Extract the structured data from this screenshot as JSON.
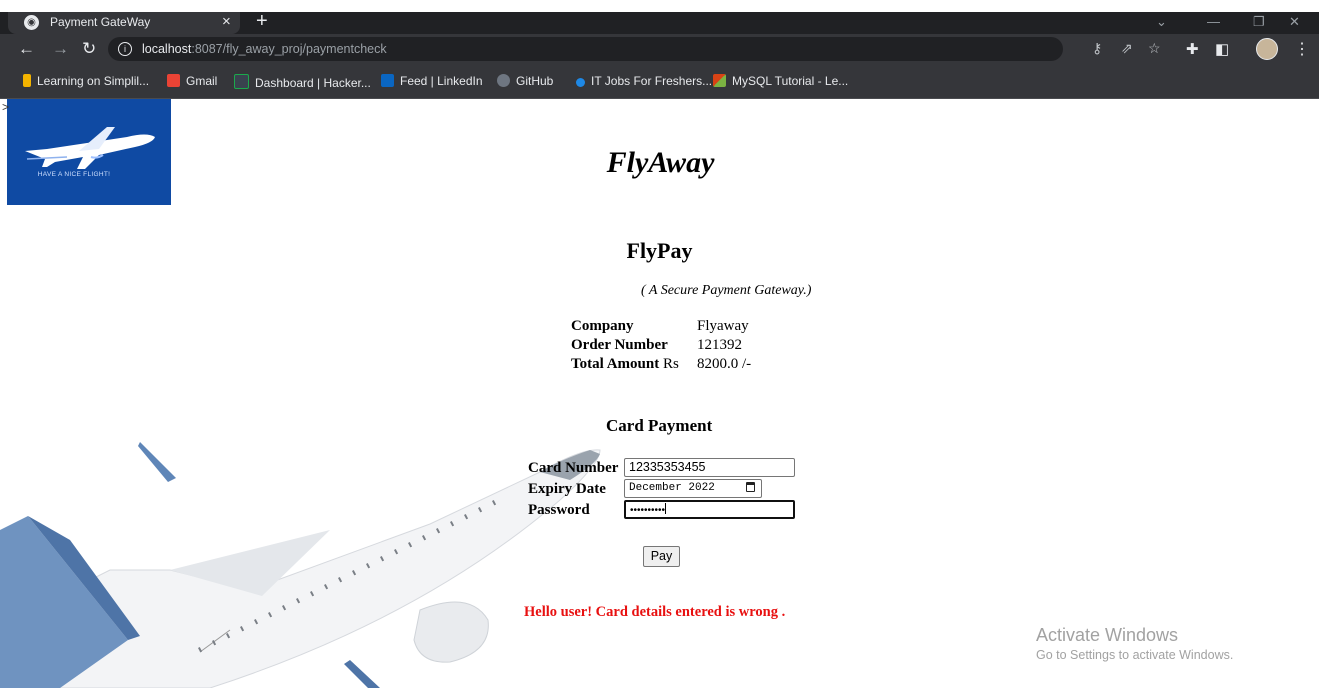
{
  "browser": {
    "tab_title": "Payment GateWay",
    "tab_close": "×",
    "new_tab": "+",
    "url_host": "localhost",
    "url_path": ":8087/fly_away_proj/paymentcheck",
    "bookmarks": [
      {
        "label": "Learning on Simplil...",
        "color": "#f4b400"
      },
      {
        "label": "Gmail",
        "color": "#ea4335"
      },
      {
        "label": "Dashboard | Hacker...",
        "color": "#0e141e"
      },
      {
        "label": "Feed | LinkedIn",
        "color": "#0a66c2"
      },
      {
        "label": "GitHub",
        "color": "#6e7681"
      },
      {
        "label": "IT Jobs For Freshers...",
        "color": "#1e88e5"
      },
      {
        "label": "MySQL Tutorial - Le...",
        "color": "#d84315"
      }
    ]
  },
  "page": {
    "stray_text": ">",
    "logo_tagline": "HAVE A NICE FLIGHT!",
    "site_title": "FlyAway",
    "pay_title": "FlyPay",
    "tagline": "( A Secure Payment Gateway.)",
    "info": [
      {
        "label": "Company",
        "value": "Flyaway"
      },
      {
        "label": "Order Number",
        "value": "121392"
      },
      {
        "label": "Total Amount",
        "label_suffix": "Rs",
        "value": "8200.0 /-"
      }
    ],
    "card_section_title": "Card Payment",
    "form": {
      "card_number_label": "Card Number",
      "card_number_value": "12335353455",
      "expiry_label": "Expiry Date",
      "expiry_value": "December 2022",
      "password_label": "Password",
      "password_mask": "••••••••••"
    },
    "pay_button": "Pay",
    "error_message": "Hello user! Card details entered is wrong ."
  },
  "watermark": {
    "title": "Activate Windows",
    "subtitle": "Go to Settings to activate Windows."
  }
}
